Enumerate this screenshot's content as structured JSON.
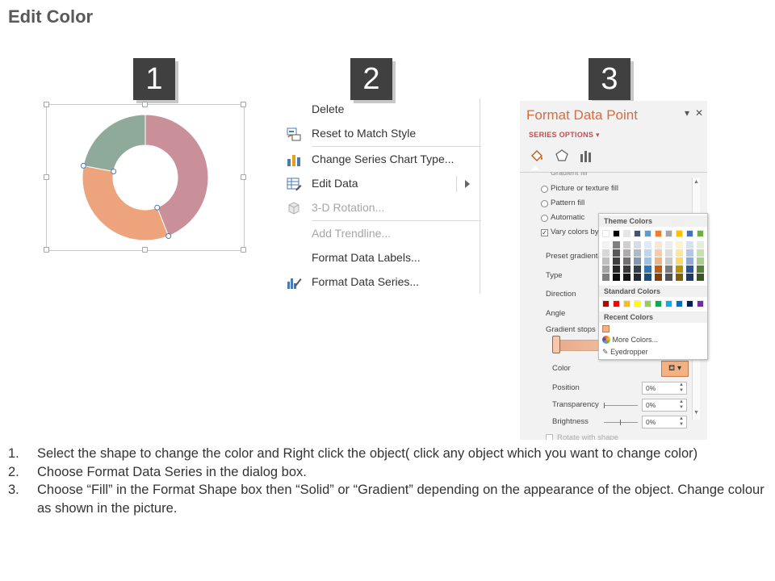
{
  "page": {
    "title": "Edit Color"
  },
  "steps": [
    {
      "number": "1"
    },
    {
      "number": "2"
    },
    {
      "number": "3"
    }
  ],
  "chart_data": {
    "type": "pie",
    "variant": "donut",
    "slices": [
      {
        "value": 44,
        "color": "#c9909a"
      },
      {
        "value": 34,
        "color": "#eda37c"
      },
      {
        "value": 22,
        "color": "#8fa99a"
      }
    ]
  },
  "context_menu": {
    "items": [
      {
        "label": "Delete",
        "icon": "",
        "enabled": true
      },
      {
        "label": "Reset to Match Style",
        "icon": "reset-style-icon",
        "enabled": true
      },
      {
        "label": "Change Series Chart Type...",
        "icon": "bar-chart-icon",
        "enabled": true
      },
      {
        "label": "Edit Data",
        "icon": "table-edit-icon",
        "enabled": true,
        "submenu": true
      },
      {
        "label": "3-D Rotation...",
        "icon": "cube-icon",
        "enabled": false
      },
      {
        "label": "Add Trendline...",
        "icon": "",
        "enabled": false
      },
      {
        "label": "Format Data Labels...",
        "icon": "",
        "enabled": true
      },
      {
        "label": "Format Data Series...",
        "icon": "format-series-icon",
        "enabled": true
      }
    ]
  },
  "format_pane": {
    "title": "Format Data Point",
    "series_options": "SERIES OPTIONS",
    "tabs": [
      "fill-line-icon",
      "pentagon-icon",
      "series-options-icon"
    ],
    "cut_option": "Gradient fill",
    "fill_options": [
      "Picture or texture fill",
      "Pattern fill",
      "Automatic"
    ],
    "vary_colors": "Vary colors by",
    "preset_gradients": "Preset gradients",
    "type": "Type",
    "direction": "Direction",
    "angle": "Angle",
    "gradient_stops": "Gradient stops",
    "color": "Color",
    "position": {
      "label": "Position",
      "value": "0%"
    },
    "transparency": {
      "label": "Transparency",
      "value": "0%"
    },
    "brightness": {
      "label": "Brightness",
      "value": "0%"
    },
    "rotate_with_shape": "Rotate with shape",
    "color_button_color": "#f4b183"
  },
  "color_picker": {
    "theme_colors_label": "Theme Colors",
    "standard_colors_label": "Standard Colors",
    "recent_colors_label": "Recent Colors",
    "more_colors": "More Colors...",
    "eyedropper": "Eyedropper",
    "theme_top_row": [
      "#ffffff",
      "#000000",
      "#e7e6e6",
      "#44546a",
      "#5b9bd5",
      "#ed7d31",
      "#a5a5a5",
      "#ffc000",
      "#4472c4",
      "#70ad47"
    ],
    "theme_shades": [
      [
        "#f2f2f2",
        "#7f7f7f",
        "#d0cece",
        "#d6dce4",
        "#deebf6",
        "#fbe5d5",
        "#ededed",
        "#fff2cc",
        "#d9e2f3",
        "#e2efd9"
      ],
      [
        "#d8d8d8",
        "#595959",
        "#aeabab",
        "#adb9ca",
        "#bdd7ee",
        "#f7cbac",
        "#dbdbdb",
        "#fee599",
        "#b4c6e7",
        "#c5e0b3"
      ],
      [
        "#bfbfbf",
        "#3f3f3f",
        "#757070",
        "#8496b0",
        "#9cc3e5",
        "#f4b183",
        "#c9c9c9",
        "#ffd965",
        "#8eaadb",
        "#a8d08d"
      ],
      [
        "#a5a5a5",
        "#262626",
        "#3a3838",
        "#323f4f",
        "#2e75b5",
        "#c55a11",
        "#7b7b7b",
        "#bf9000",
        "#2f5496",
        "#538135"
      ],
      [
        "#7f7f7f",
        "#0c0c0c",
        "#171616",
        "#222a35",
        "#1e4e79",
        "#833c0b",
        "#525252",
        "#7f6000",
        "#1f3864",
        "#375623"
      ]
    ],
    "standard": [
      "#c00000",
      "#ff0000",
      "#ffc000",
      "#ffff00",
      "#92d050",
      "#00b050",
      "#00b0f0",
      "#0070c0",
      "#002060",
      "#7030a0"
    ],
    "recent": [
      "#f4b183"
    ]
  },
  "instructions": [
    {
      "num": "1.",
      "text": "Select the shape to change the color and Right click the object( click any object which you want to change color)"
    },
    {
      "num": "2.",
      "text": "Choose Format Data Series in the dialog box."
    },
    {
      "num": "3.",
      "text": "Choose “Fill” in the Format Shape box then “Solid” or “Gradient” depending on the appearance of the object. Change colour as shown in the picture."
    }
  ]
}
